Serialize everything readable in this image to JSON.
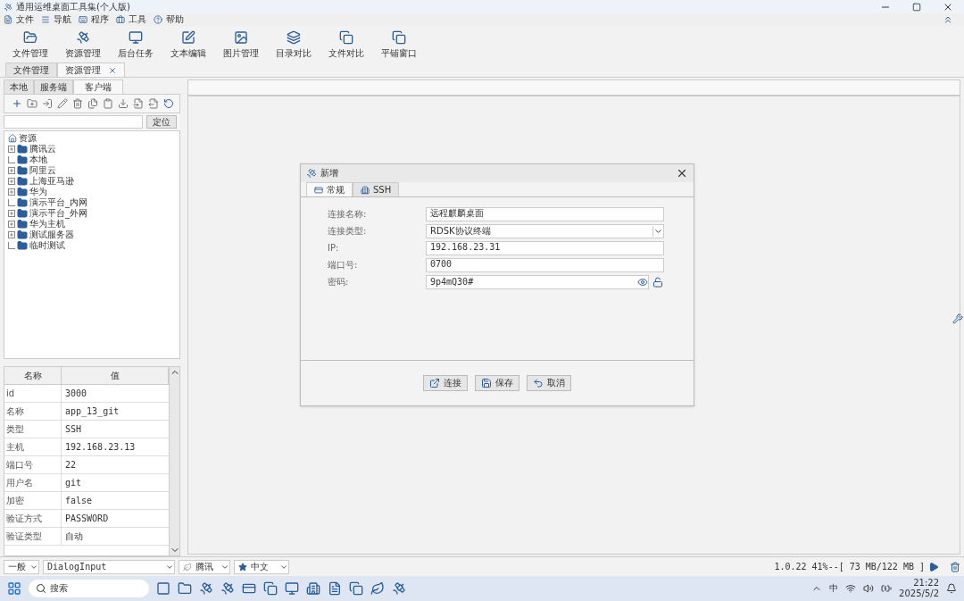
{
  "window": {
    "title": "通用运维桌面工具集(个人版)"
  },
  "menu": [
    "文件",
    "导航",
    "程序",
    "工具",
    "帮助"
  ],
  "toolbar": [
    "文件管理",
    "资源管理",
    "后台任务",
    "文本编辑",
    "图片管理",
    "目录对比",
    "文件对比",
    "平铺窗口"
  ],
  "doc_tabs": [
    {
      "label": "文件管理",
      "selected": false
    },
    {
      "label": "资源管理",
      "selected": true
    }
  ],
  "side_tabs": [
    {
      "label": "本地",
      "selected": false
    },
    {
      "label": "服务端",
      "selected": false
    },
    {
      "label": "客户端",
      "selected": true
    }
  ],
  "locate_button": "定位",
  "tree": {
    "label": "资源",
    "children": [
      {
        "label": "腾讯云",
        "expandable": true
      },
      {
        "label": "本地",
        "expandable": false
      },
      {
        "label": "阿里云",
        "expandable": true
      },
      {
        "label": "上海亚马逊",
        "expandable": true
      },
      {
        "label": "华为",
        "expandable": true
      },
      {
        "label": "演示平台_内网",
        "expandable": false
      },
      {
        "label": "演示平台_外网",
        "expandable": true
      },
      {
        "label": "华为主机",
        "expandable": true
      },
      {
        "label": "测试服务器",
        "expandable": true
      },
      {
        "label": "临时测试",
        "expandable": false
      }
    ]
  },
  "properties": {
    "columns": [
      "名称",
      "值"
    ],
    "rows": [
      [
        "id",
        "3000"
      ],
      [
        "名称",
        "app_13_git"
      ],
      [
        "类型",
        "SSH"
      ],
      [
        "主机",
        "192.168.23.13"
      ],
      [
        "端口号",
        "22"
      ],
      [
        "用户名",
        "git"
      ],
      [
        "加密",
        "false"
      ],
      [
        "验证方式",
        "PASSWORD"
      ],
      [
        "验证类型",
        "自动"
      ]
    ]
  },
  "dialog": {
    "title": "新增",
    "tabs": [
      {
        "label": "常规",
        "selected": true
      },
      {
        "label": "SSH",
        "selected": false
      }
    ],
    "fields": [
      {
        "kind": "text",
        "label": "连接名称:",
        "value": "远程麒麟桌面"
      },
      {
        "kind": "select",
        "label": "连接类型:",
        "value": "RDSK协议终端"
      },
      {
        "kind": "text",
        "label": "IP:",
        "value": "192.168.23.31"
      },
      {
        "kind": "text",
        "label": "端口号:",
        "value": "0700"
      },
      {
        "kind": "password",
        "label": "密码:",
        "value": "9p4mQ30#"
      }
    ],
    "buttons": [
      "连接",
      "保存",
      "取消"
    ]
  },
  "status_bar": {
    "combos": [
      "一般",
      "DialogInput",
      "腾讯",
      "中文"
    ],
    "info": "1.0.22 41%--[ 73 MB/122 MB ]"
  },
  "taskbar": {
    "search": "搜索",
    "ime": "中",
    "time": "21:22",
    "date": "2025/5/2"
  }
}
